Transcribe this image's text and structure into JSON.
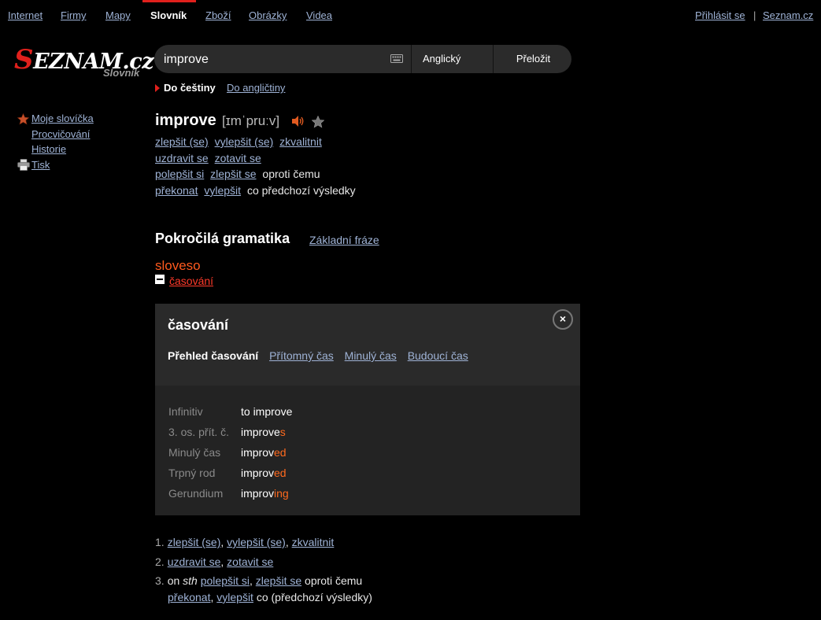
{
  "nav": {
    "items": [
      "Internet",
      "Firmy",
      "Mapy",
      "Slovník",
      "Zboží",
      "Obrázky",
      "Videa"
    ],
    "login": "Přihlásit se",
    "separator": "|",
    "home": "Seznam.cz"
  },
  "logo": {
    "brand_s": "S",
    "brand_rest": "EZNAM.cz",
    "sub": "Slovník"
  },
  "search": {
    "value": "improve",
    "language": "Anglický",
    "translate_button": "Přeložit",
    "dir_current": "Do češtiny",
    "dir_other": "Do angličtiny"
  },
  "sidebar": {
    "my_words": "Moje slovíčka",
    "practice": "Procvičování",
    "history": "Historie",
    "print": "Tisk"
  },
  "entry": {
    "word": "improve",
    "pronunciation": "[ɪmˈpruːv]",
    "lines": [
      {
        "links": [
          "zlepšit (se)",
          "vylepšit (se)",
          "zkvalitnit"
        ],
        "plain": ""
      },
      {
        "links": [
          "uzdravit se",
          "zotavit se"
        ],
        "plain": ""
      },
      {
        "links": [
          "polepšit si",
          "zlepšit se"
        ],
        "plain": "oproti čemu"
      },
      {
        "links": [
          "překonat",
          "vylepšit"
        ],
        "plain": "co předchozí výsledky"
      }
    ]
  },
  "grammar": {
    "title": "Pokročilá gramatika",
    "basic_link": "Základní fráze",
    "pos": "sloveso",
    "conj_toggle": "časování"
  },
  "panel": {
    "title": "časování",
    "close": "×",
    "tab_current": "Přehled časování",
    "tabs": [
      "Přítomný čas",
      "Minulý čas",
      "Budoucí čas"
    ],
    "rows": [
      {
        "label": "Infinitiv",
        "stem": "to improve",
        "suffix": ""
      },
      {
        "label": "3. os. přít. č.",
        "stem": "improve",
        "suffix": "s"
      },
      {
        "label": "Minulý čas",
        "stem": "improv",
        "suffix": "ed"
      },
      {
        "label": "Trpný rod",
        "stem": "improv",
        "suffix": "ed"
      },
      {
        "label": "Gerundium",
        "stem": "improv",
        "suffix": "ing"
      }
    ]
  },
  "numbered": {
    "n1": "1.",
    "n1_a": "zlepšit (se)",
    "n1_b": "vylepšit (se)",
    "n1_c": "zkvalitnit",
    "n2": "2.",
    "n2_a": "uzdravit se",
    "n2_b": "zotavit se",
    "n3": "3.",
    "n3_on": "on",
    "n3_sth": "sth",
    "n3_a": "polepšit si",
    "n3_b": "zlepšit se",
    "n3_plain": "oproti čemu",
    "n4_a": "překonat",
    "n4_b": "vylepšit",
    "n4_plain": "co (předchozí výsledky)",
    "comma": ","
  },
  "colors": {
    "accent": "#e0201c",
    "suffix": "#ff6a1e",
    "link": "#9fb3d6"
  }
}
